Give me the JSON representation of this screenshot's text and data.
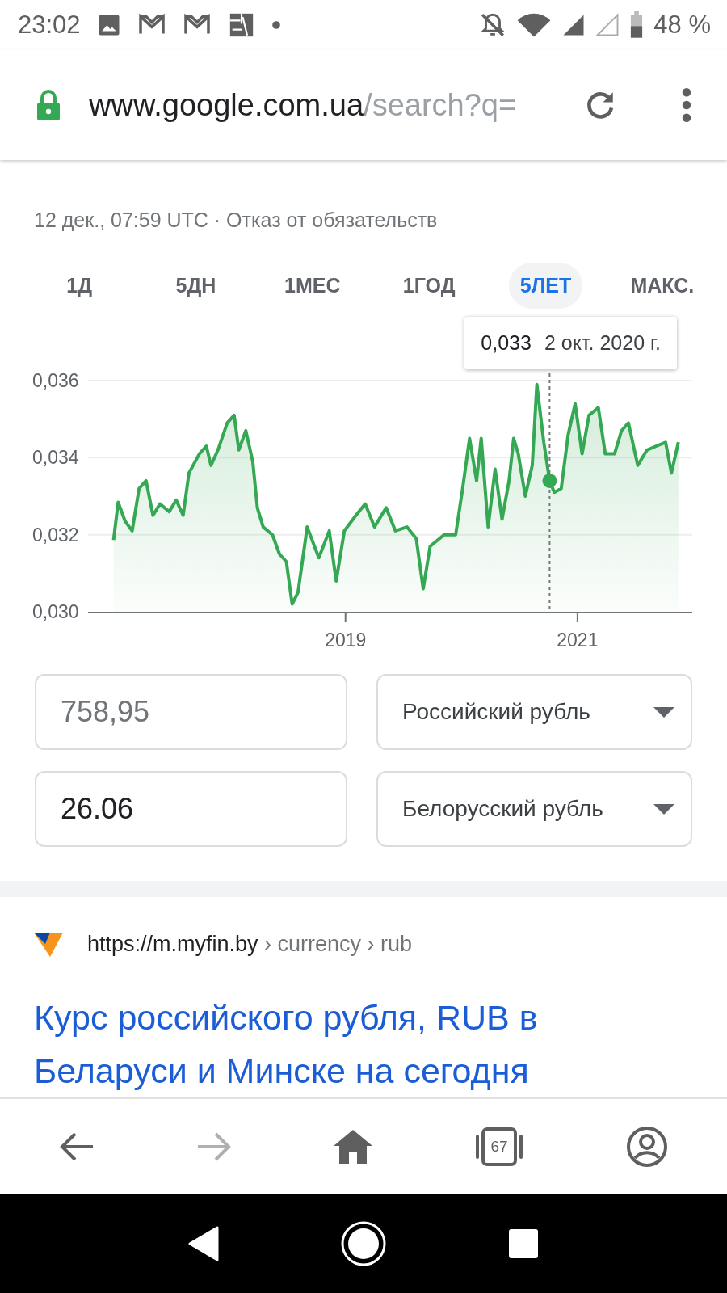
{
  "status_bar": {
    "time": "23:02",
    "battery": "48 %"
  },
  "address_bar": {
    "host": "www.google.com.ua",
    "path": "/search?q="
  },
  "subtitle": "12 дек., 07:59 UTC · Отказ от обязательств",
  "range_tabs": [
    {
      "label": "1Д",
      "selected": false
    },
    {
      "label": "5ДН",
      "selected": false
    },
    {
      "label": "1МЕС",
      "selected": false
    },
    {
      "label": "1ГОД",
      "selected": false
    },
    {
      "label": "5ЛЕТ",
      "selected": true
    },
    {
      "label": "МАКС.",
      "selected": false
    }
  ],
  "chart": {
    "chart_data": {
      "type": "area",
      "x": [
        2017.0,
        2017.04,
        2017.1,
        2017.16,
        2017.22,
        2017.28,
        2017.34,
        2017.4,
        2017.48,
        2017.54,
        2017.6,
        2017.65,
        2017.74,
        2017.8,
        2017.84,
        2017.9,
        2017.98,
        2018.04,
        2018.08,
        2018.14,
        2018.2,
        2018.24,
        2018.29,
        2018.37,
        2018.43,
        2018.49,
        2018.54,
        2018.59,
        2018.67,
        2018.77,
        2018.86,
        2018.92,
        2018.99,
        2019.09,
        2019.17,
        2019.25,
        2019.35,
        2019.43,
        2019.53,
        2019.61,
        2019.67,
        2019.73,
        2019.85,
        2019.95,
        2020.01,
        2020.07,
        2020.13,
        2020.17,
        2020.23,
        2020.29,
        2020.35,
        2020.41,
        2020.45,
        2020.49,
        2020.55,
        2020.61,
        2020.65,
        2020.71,
        2020.76,
        2020.8,
        2020.86,
        2020.92,
        2020.98,
        2021.04,
        2021.1,
        2021.18,
        2021.24,
        2021.32,
        2021.38,
        2021.44,
        2021.52,
        2021.6,
        2021.68,
        2021.76,
        2021.81,
        2021.87
      ],
      "series": [
        {
          "color": "#34a853",
          "values": [
            0.03186,
            0.03284,
            0.03235,
            0.0321,
            0.0332,
            0.0334,
            0.0325,
            0.0328,
            0.0326,
            0.0329,
            0.0325,
            0.0336,
            0.0341,
            0.0343,
            0.0338,
            0.0342,
            0.0349,
            0.0351,
            0.0342,
            0.0347,
            0.0339,
            0.0327,
            0.0322,
            0.032,
            0.0315,
            0.0313,
            0.0302,
            0.0305,
            0.0322,
            0.0314,
            0.0321,
            0.0308,
            0.0321,
            0.0325,
            0.0328,
            0.0322,
            0.0327,
            0.0321,
            0.0322,
            0.0319,
            0.0306,
            0.0317,
            0.032,
            0.032,
            0.0332,
            0.0345,
            0.0334,
            0.0345,
            0.0322,
            0.0337,
            0.0324,
            0.0334,
            0.0345,
            0.0341,
            0.033,
            0.0338,
            0.0359,
            0.0344,
            0.0334,
            0.0331,
            0.0332,
            0.0346,
            0.0354,
            0.0341,
            0.0351,
            0.0353,
            0.0341,
            0.0341,
            0.0347,
            0.0349,
            0.0338,
            0.0342,
            0.0343,
            0.0344,
            0.0336,
            0.0344
          ]
        }
      ],
      "xlim": [
        2016.78,
        2021.99
      ],
      "ylim": [
        0.03,
        0.036
      ],
      "xticks": [
        2019,
        2021
      ],
      "yticks": [
        {
          "value": 0.03,
          "label": "0,030"
        },
        {
          "value": 0.032,
          "label": "0,032"
        },
        {
          "value": 0.034,
          "label": "0,034"
        },
        {
          "value": 0.036,
          "label": "0,036"
        }
      ],
      "ref_lines": [
        {
          "axis": "x",
          "value": 2020.76
        }
      ]
    },
    "tooltip": {
      "value": "0,033",
      "date": "2 окт. 2020 г."
    }
  },
  "converter": {
    "rows": [
      {
        "amount": {
          "placeholder": "758,95"
        },
        "currency": "Российский рубль"
      },
      {
        "amount": {
          "value": "26.06"
        },
        "currency": "Белорусский рубль"
      }
    ]
  },
  "result": {
    "url": "https://m.myfin.by",
    "breadcrumb": "› currency › rub",
    "title": "Курс российского рубля, RUB в Беларуси и Минске на сегодня"
  },
  "toolbar": {
    "back_disabled": false,
    "forward_disabled": true,
    "tab_count": "67"
  }
}
